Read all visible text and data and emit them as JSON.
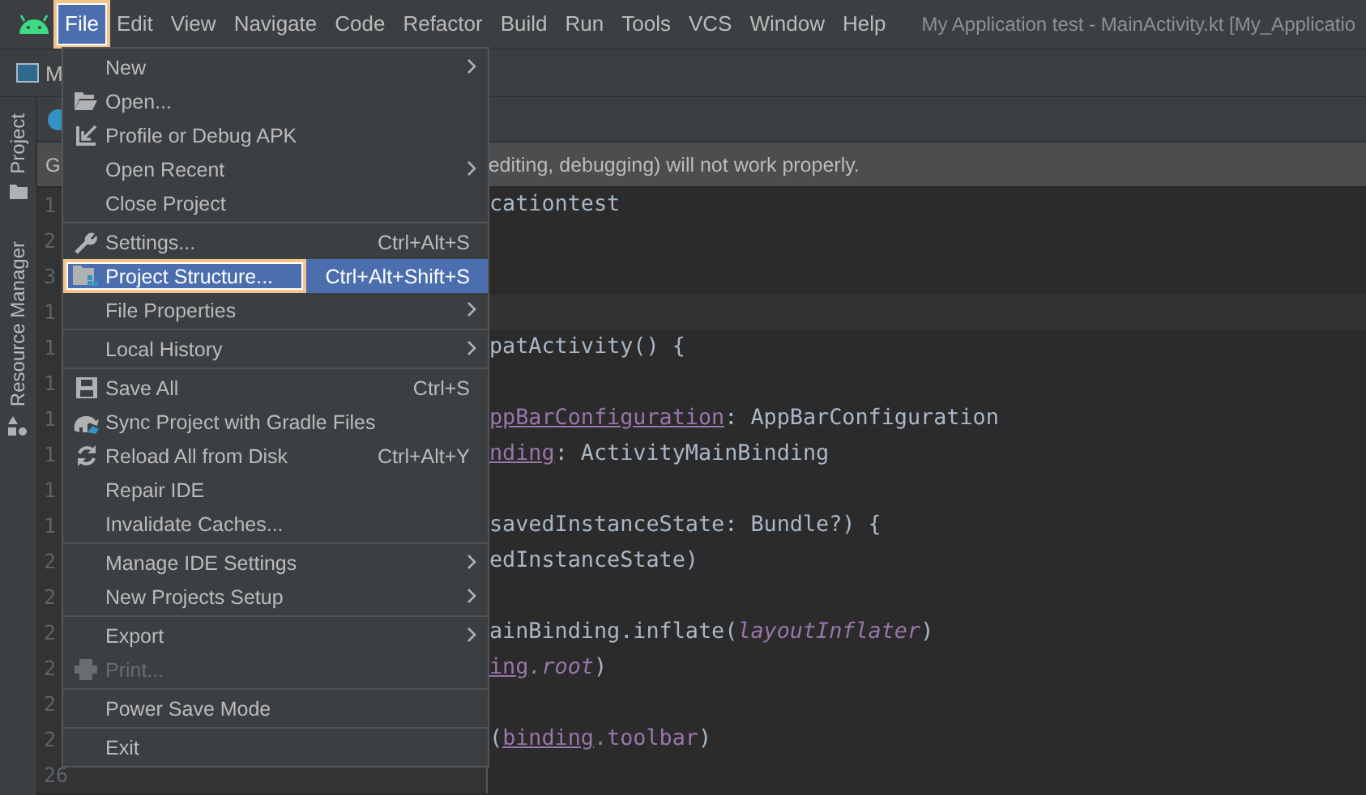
{
  "menubar": {
    "items": [
      {
        "label": "File",
        "selected": true,
        "outlined": true
      },
      {
        "label": "Edit",
        "selected": false,
        "outlined": false
      },
      {
        "label": "View",
        "selected": false,
        "outlined": false
      },
      {
        "label": "Navigate",
        "selected": false,
        "outlined": false
      },
      {
        "label": "Code",
        "selected": false,
        "outlined": false
      },
      {
        "label": "Refactor",
        "selected": false,
        "outlined": false
      },
      {
        "label": "Build",
        "selected": false,
        "outlined": false
      },
      {
        "label": "Run",
        "selected": false,
        "outlined": false
      },
      {
        "label": "Tools",
        "selected": false,
        "outlined": false
      },
      {
        "label": "VCS",
        "selected": false,
        "outlined": false
      },
      {
        "label": "Window",
        "selected": false,
        "outlined": false
      },
      {
        "label": "Help",
        "selected": false,
        "outlined": false
      }
    ],
    "window_title": "My Application test - MainActivity.kt [My_Applicatio"
  },
  "toolbar": {
    "project_label": "M"
  },
  "side_tabs": [
    "Project",
    "Resource Manager"
  ],
  "notification": {
    "start": "G",
    "end": "editing, debugging) will not work properly."
  },
  "editor": {
    "lines": [
      {
        "number": "1",
        "current": false,
        "code": [
          {
            "kind": "plain",
            "text": "cationtest"
          }
        ]
      },
      {
        "number": "2",
        "current": false
      },
      {
        "number": "3",
        "current": false
      },
      {
        "number": "1",
        "current": true
      },
      {
        "number": "1",
        "current": false,
        "code": [
          {
            "kind": "plain",
            "text": "patActivity() {"
          }
        ]
      },
      {
        "number": "1",
        "current": false
      },
      {
        "number": "1",
        "current": false,
        "code": [
          {
            "kind": "field",
            "text": "ppBarConfiguration"
          },
          {
            "kind": "plain",
            "text": ": AppBarConfiguration"
          }
        ]
      },
      {
        "number": "1",
        "current": false,
        "code": [
          {
            "kind": "field",
            "text": "nding"
          },
          {
            "kind": "plain",
            "text": ": ActivityMainBinding"
          }
        ]
      },
      {
        "number": "1",
        "current": false
      },
      {
        "number": "1",
        "current": false,
        "code": [
          {
            "kind": "plain",
            "text": "savedInstanceState: Bundle?) {"
          }
        ]
      },
      {
        "number": "2",
        "current": false,
        "code": [
          {
            "kind": "plain",
            "text": "edInstanceState)"
          }
        ]
      },
      {
        "number": "2",
        "current": false
      },
      {
        "number": "2",
        "current": false,
        "code": [
          {
            "kind": "plain",
            "text": "ainBinding.inflate("
          },
          {
            "kind": "italic",
            "text": "layoutInflater"
          },
          {
            "kind": "plain",
            "text": ")"
          }
        ]
      },
      {
        "number": "2",
        "current": false,
        "code": [
          {
            "kind": "field",
            "text": "ing"
          },
          {
            "kind": "italic",
            "text": ".root"
          },
          {
            "kind": "plain",
            "text": ")"
          }
        ]
      },
      {
        "number": "2",
        "current": false
      },
      {
        "number": "2",
        "current": false,
        "code": [
          {
            "kind": "plain",
            "text": "("
          },
          {
            "kind": "field",
            "text": "binding"
          },
          {
            "kind": "property",
            "text": ".toolbar"
          },
          {
            "kind": "plain",
            "text": ")"
          }
        ]
      },
      {
        "number": "26",
        "current": false
      }
    ]
  },
  "file_menu": {
    "items": [
      {
        "kind": "item",
        "label": "New",
        "submenu": true,
        "selected": false,
        "disabled": false,
        "outlined": false
      },
      {
        "kind": "item",
        "label": "Open...",
        "submenu": false,
        "selected": false,
        "disabled": false,
        "outlined": false
      },
      {
        "kind": "item",
        "label": "Profile or Debug APK",
        "submenu": false,
        "selected": false,
        "disabled": false,
        "outlined": false
      },
      {
        "kind": "item",
        "label": "Open Recent",
        "submenu": true,
        "selected": false,
        "disabled": false,
        "outlined": false
      },
      {
        "kind": "item",
        "label": "Close Project",
        "submenu": false,
        "selected": false,
        "disabled": false,
        "outlined": false
      },
      {
        "kind": "separator"
      },
      {
        "kind": "item",
        "label": "Settings...",
        "shortcut": "Ctrl+Alt+S",
        "submenu": false,
        "selected": false,
        "disabled": false,
        "outlined": false
      },
      {
        "kind": "item",
        "label": "Project Structure...",
        "shortcut": "Ctrl+Alt+Shift+S",
        "submenu": false,
        "selected": true,
        "disabled": false,
        "outlined": true
      },
      {
        "kind": "item",
        "label": "File Properties",
        "submenu": true,
        "selected": false,
        "disabled": false,
        "outlined": false
      },
      {
        "kind": "separator"
      },
      {
        "kind": "item",
        "label": "Local History",
        "submenu": true,
        "selected": false,
        "disabled": false,
        "outlined": false
      },
      {
        "kind": "separator"
      },
      {
        "kind": "item",
        "label": "Save All",
        "shortcut": "Ctrl+S",
        "submenu": false,
        "selected": false,
        "disabled": false,
        "outlined": false
      },
      {
        "kind": "item",
        "label": "Sync Project with Gradle Files",
        "submenu": false,
        "selected": false,
        "disabled": false,
        "outlined": false
      },
      {
        "kind": "item",
        "label": "Reload All from Disk",
        "shortcut": "Ctrl+Alt+Y",
        "submenu": false,
        "selected": false,
        "disabled": false,
        "outlined": false
      },
      {
        "kind": "item",
        "label": "Repair IDE",
        "submenu": false,
        "selected": false,
        "disabled": false,
        "outlined": false
      },
      {
        "kind": "item",
        "label": "Invalidate Caches...",
        "submenu": false,
        "selected": false,
        "disabled": false,
        "outlined": false
      },
      {
        "kind": "separator"
      },
      {
        "kind": "item",
        "label": "Manage IDE Settings",
        "submenu": true,
        "selected": false,
        "disabled": false,
        "outlined": false
      },
      {
        "kind": "item",
        "label": "New Projects Setup",
        "submenu": true,
        "selected": false,
        "disabled": false,
        "outlined": false
      },
      {
        "kind": "separator"
      },
      {
        "kind": "item",
        "label": "Export",
        "submenu": true,
        "selected": false,
        "disabled": false,
        "outlined": false
      },
      {
        "kind": "item",
        "label": "Print...",
        "submenu": false,
        "selected": false,
        "disabled": true,
        "outlined": false
      },
      {
        "kind": "separator"
      },
      {
        "kind": "item",
        "label": "Power Save Mode",
        "submenu": false,
        "selected": false,
        "disabled": false,
        "outlined": false
      },
      {
        "kind": "separator"
      },
      {
        "kind": "item",
        "label": "Exit",
        "submenu": false,
        "selected": false,
        "disabled": false,
        "outlined": false
      }
    ]
  }
}
